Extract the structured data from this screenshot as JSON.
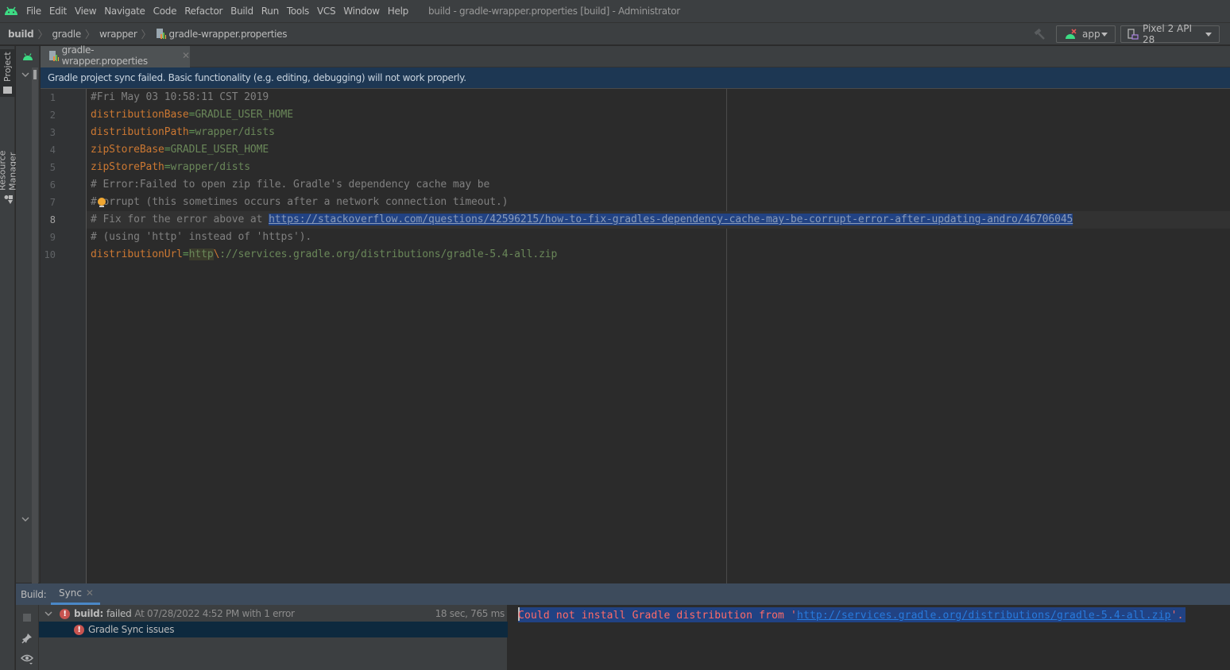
{
  "menubar": {
    "items": [
      "File",
      "Edit",
      "View",
      "Navigate",
      "Code",
      "Refactor",
      "Build",
      "Run",
      "Tools",
      "VCS",
      "Window",
      "Help"
    ],
    "window_title": "build - gradle-wrapper.properties [build] - Administrator"
  },
  "breadcrumbs": [
    "build",
    "gradle",
    "wrapper",
    "gradle-wrapper.properties"
  ],
  "toolbar": {
    "run_config": "app",
    "device": "Pixel 2 API 28",
    "icons": [
      "android-logo-icon",
      "hammer-icon",
      "android-error-icon",
      "device-icon"
    ]
  },
  "left_strip": {
    "tabs": [
      "Project",
      "Resource Manager"
    ]
  },
  "editor": {
    "tab": {
      "label": "gradle-wrapper.properties",
      "close": "✕"
    },
    "banner": "Gradle project sync failed. Basic functionality (e.g. editing, debugging) will not work properly.",
    "current_line": 8,
    "line_numbers": [
      "1",
      "2",
      "3",
      "4",
      "5",
      "6",
      "7",
      "8",
      "9",
      "10"
    ],
    "lines": [
      {
        "comment": "#Fri May 03 10:58:11 CST 2019"
      },
      {
        "key": "distributionBase",
        "eq": "=",
        "value": "GRADLE_USER_HOME"
      },
      {
        "key": "distributionPath",
        "eq": "=",
        "value": "wrapper/dists"
      },
      {
        "key": "zipStoreBase",
        "eq": "=",
        "value": "GRADLE_USER_HOME"
      },
      {
        "key": "zipStorePath",
        "eq": "=",
        "value": "wrapper/dists"
      },
      {
        "comment": "# Error:Failed to open zip file. Gradle's dependency cache may be"
      },
      {
        "comment_a": "#",
        "comment_b": "corrupt (this sometimes occurs after a network connection timeout.)"
      },
      {
        "comment": "# Fix for the error above at ",
        "link": "https://stackoverflow.com/questions/42596215/how-to-fix-gradles-dependency-cache-may-be-corrupt-error-after-updating-andro/46706045"
      },
      {
        "comment": "# (using 'http' instead of 'https')."
      },
      {
        "key": "distributionUrl",
        "eq": "=",
        "value_highlight": "http",
        "escape": "\\",
        "value": "://services.gradle.org/distributions/gradle-5.4-all.zip"
      }
    ]
  },
  "build_window": {
    "title": "Build:",
    "tab": {
      "label": "Sync",
      "close": "✕"
    },
    "tree": [
      {
        "expander": "⌄",
        "label_bold": "build:",
        "label": "failed",
        "detail": "At 07/28/2022 4:52 PM with 1 error",
        "duration": "18 sec, 765 ms"
      },
      {
        "label": "Gradle Sync issues"
      }
    ],
    "console": {
      "prefix": "Could not install Gradle distribution from '",
      "link": "http://services.gradle.org/distributions/gradle-5.4-all.zip",
      "suffix": "'."
    }
  },
  "colors": {
    "banner_bg": "#1d3753",
    "error": "#c75450",
    "link": "#287bde",
    "keyword": "#cc7832",
    "string": "#6a8759",
    "selection": "#214283"
  }
}
